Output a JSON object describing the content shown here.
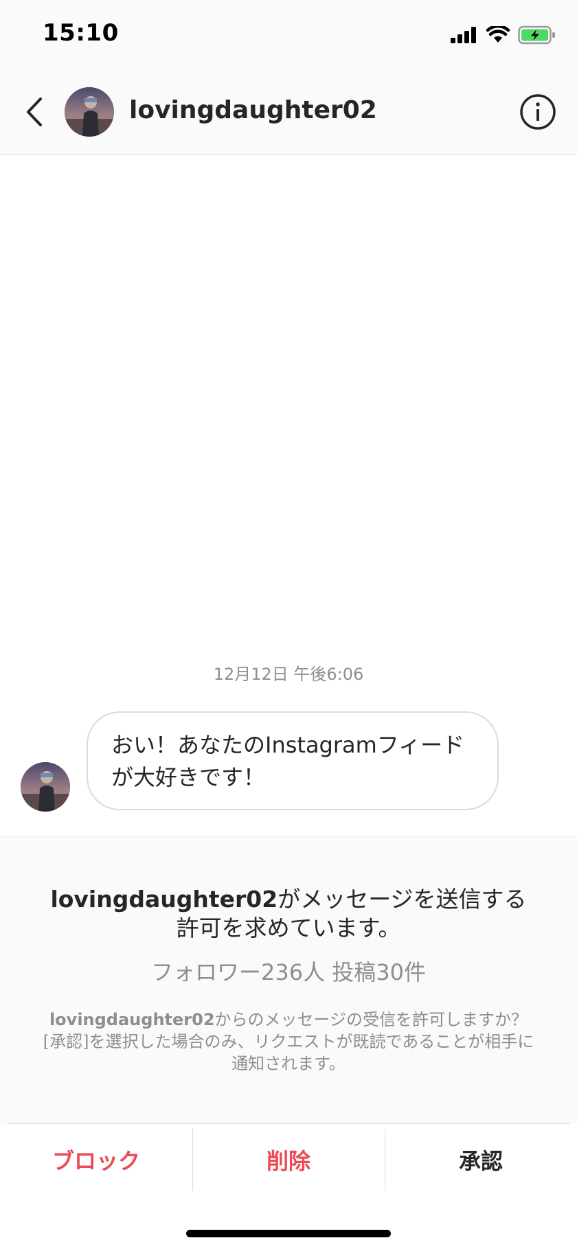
{
  "status_bar": {
    "time": "15:10",
    "icons": [
      "signal-icon",
      "wifi-icon",
      "battery-charging-icon"
    ]
  },
  "header": {
    "back_icon": "chevron-left-icon",
    "username": "lovingdaughter02",
    "info_icon": "info-icon"
  },
  "chat": {
    "timestamp": "12月12日 午後6:06",
    "messages": [
      {
        "sender": "lovingdaughter02",
        "text_line1": "おい！あなたのInstagramフィード",
        "text_line2": "が大好きです！"
      }
    ]
  },
  "request": {
    "username": "lovingdaughter02",
    "title_suffix": "がメッセージを送信する許可を求めています。",
    "stats": "フォロワー236人 投稿30件",
    "note_username": "lovingdaughter02",
    "note_text": "からのメッセージの受信を許可しますか？[承認]を選択した場合のみ、リクエストが既読であることが相手に通知されます。"
  },
  "actions": {
    "block_label": "ブロック",
    "delete_label": "削除",
    "accept_label": "承認"
  },
  "colors": {
    "danger": "#ed4956",
    "text_primary": "#262626",
    "text_secondary": "#8e8e8e",
    "battery_green": "#4cd964"
  }
}
